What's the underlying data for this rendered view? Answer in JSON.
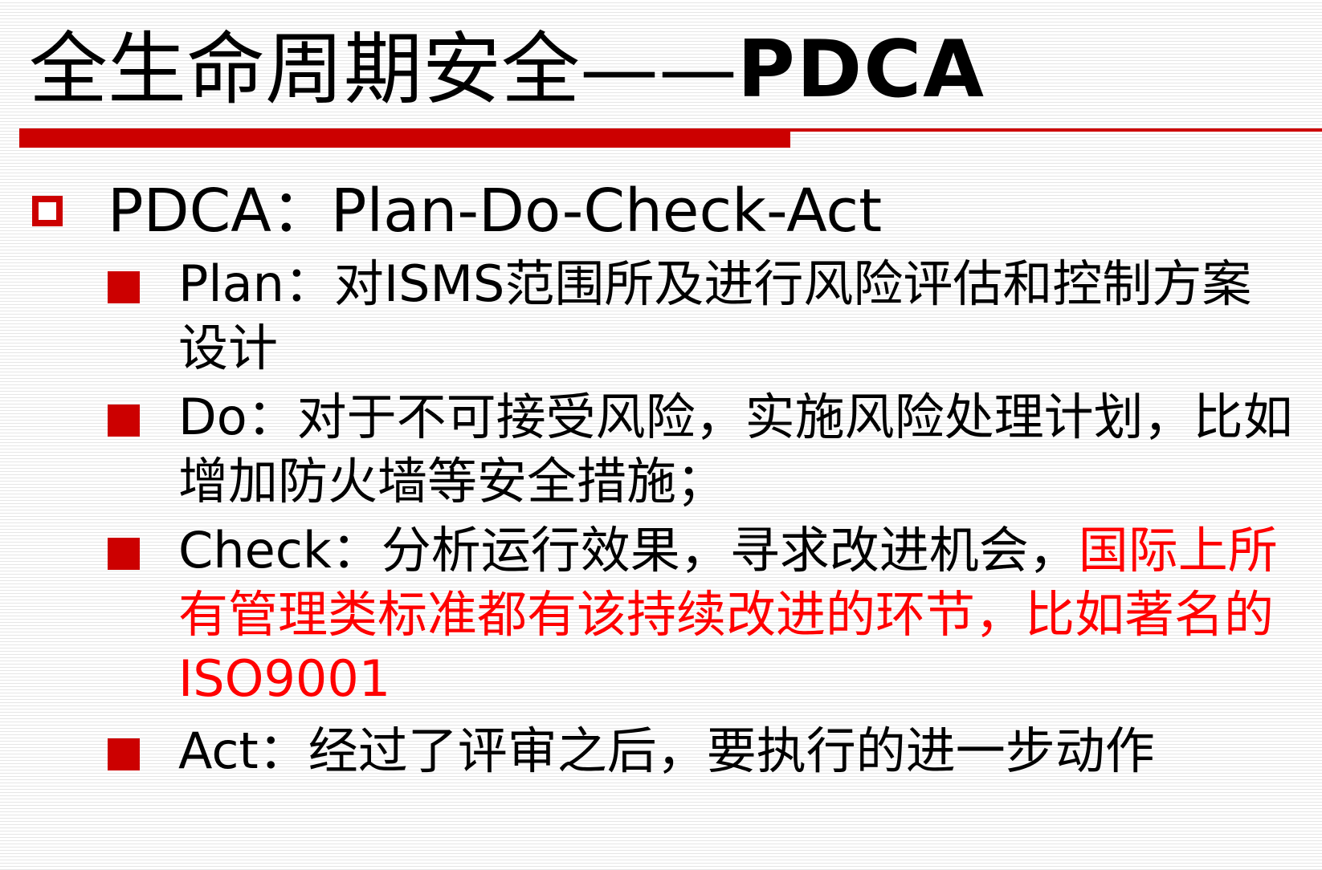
{
  "slide": {
    "title": {
      "main": "全生命周期安全——",
      "latin": "PDCA"
    },
    "bullet": {
      "text": "PDCA：Plan-Do-Check-Act"
    },
    "items": [
      {
        "text": "Plan：对ISMS范围所及进行风险评估和控制方案设计"
      },
      {
        "text": "Do：对于不可接受风险，实施风险处理计划，比如增加防火墙等安全措施；"
      },
      {
        "text": "Check：分析运行效果，寻求改进机会，",
        "highlight": "国际上所有管理类标准都有该持续改进的环节，比如著名的ISO9001"
      },
      {
        "text": "Act：经过了评审之后，要执行的进一步动作"
      }
    ]
  },
  "colors": {
    "accent": "#cc0000",
    "highlight_text": "#ff0000",
    "text": "#000000",
    "background": "#ffffff"
  }
}
